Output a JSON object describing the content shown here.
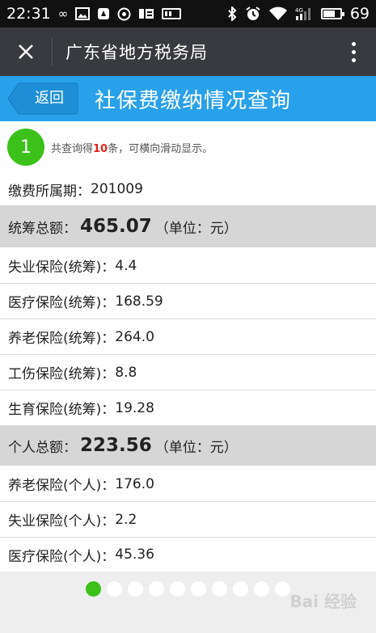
{
  "status_bar": {
    "time": "22:31",
    "battery": "69",
    "battery_level": 0.69,
    "left_icons": [
      "infinity-icon",
      "image-icon",
      "app-icon",
      "refresh-icon",
      "taobao-icon",
      "sd-card-icon"
    ],
    "right_icons": [
      "bluetooth-icon",
      "alarm-icon",
      "wifi-icon",
      "signal-4g-icon",
      "battery-icon"
    ]
  },
  "titlebar": {
    "title": "广东省地方税务局"
  },
  "header": {
    "back_label": "返回",
    "title": "社保费缴纳情况查询"
  },
  "result": {
    "badge": "1",
    "prefix": "共查询得",
    "count": "10",
    "suffix": "条，可横向滑动显示。"
  },
  "period": {
    "label": "缴费所属期：",
    "value": "201009"
  },
  "pooled_total": {
    "label": "统筹总额：",
    "value": "465.07",
    "unit": "（单位：元）"
  },
  "pooled_items": [
    {
      "label": "失业保险(统筹)：",
      "value": "4.4"
    },
    {
      "label": "医疗保险(统筹)：",
      "value": "168.59"
    },
    {
      "label": "养老保险(统筹)：",
      "value": "264.0"
    },
    {
      "label": "工伤保险(统筹)：",
      "value": "8.8"
    },
    {
      "label": "生育保险(统筹)：",
      "value": "19.28"
    }
  ],
  "personal_total": {
    "label": "个人总额：",
    "value": "223.56",
    "unit": "（单位：元）"
  },
  "personal_items": [
    {
      "label": "养老保险(个人)：",
      "value": "176.0"
    },
    {
      "label": "失业保险(个人)：",
      "value": "2.2"
    },
    {
      "label": "医疗保险(个人)：",
      "value": "45.36"
    }
  ],
  "pager": {
    "total_pages": 10,
    "current_page": 1
  },
  "watermark": "Bai 经验",
  "colors": {
    "header_blue": "#29a0ea",
    "accent_green": "#3cc01a",
    "count_red": "#e2221c",
    "titlebar": "#393a3f"
  }
}
